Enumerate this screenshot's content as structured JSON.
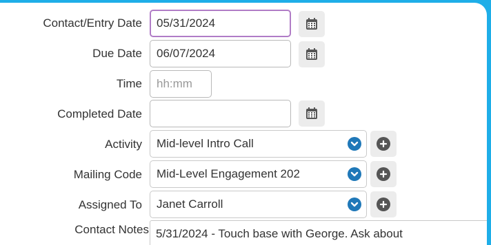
{
  "form": {
    "contact_entry_date": {
      "label": "Contact/Entry Date",
      "value": "05/31/2024"
    },
    "due_date": {
      "label": "Due Date",
      "value": "06/07/2024"
    },
    "time": {
      "label": "Time",
      "placeholder": "hh:mm",
      "value": ""
    },
    "completed_date": {
      "label": "Completed Date",
      "value": ""
    },
    "activity": {
      "label": "Activity",
      "value": "Mid-level Intro Call"
    },
    "mailing_code": {
      "label": "Mailing Code",
      "value": "Mid-Level Engagement 202"
    },
    "assigned_to": {
      "label": "Assigned To",
      "value": "Janet Carroll"
    },
    "contact_notes": {
      "label": "Contact Notes",
      "value": "5/31/2024 - Touch base with George.  Ask about"
    }
  },
  "icons": {
    "calendar": "calendar-icon",
    "chevron": "chevron-down-icon",
    "add": "plus-icon"
  },
  "colors": {
    "background": "#1eaee8",
    "focus_border": "#b07cc6",
    "chevron_bg": "#1f78b8",
    "plus_bg": "#555555"
  }
}
